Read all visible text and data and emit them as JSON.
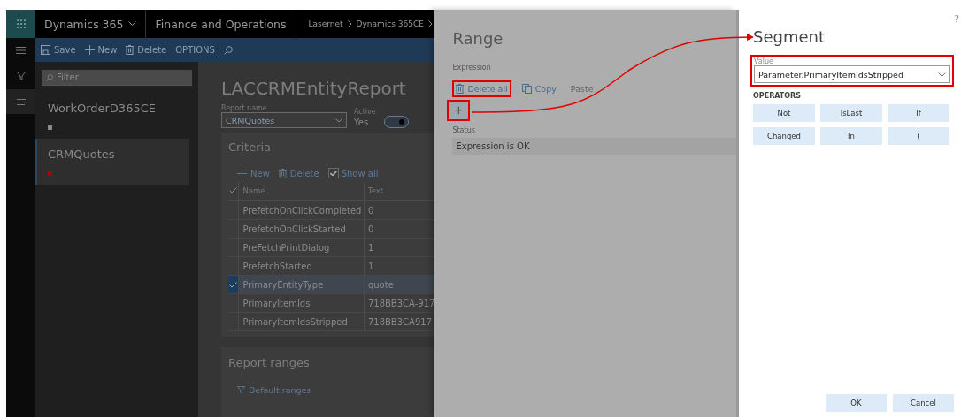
{
  "app_bar": {
    "product": "Dynamics 365",
    "module": "Finance and Operations",
    "breadcrumb": [
      "Lasernet",
      "Dynamics 365CE"
    ]
  },
  "action_pane": {
    "buttons": [
      {
        "label": "Save",
        "kind": "save"
      },
      {
        "label": "New",
        "kind": "new"
      },
      {
        "label": "Delete",
        "kind": "delete"
      },
      {
        "label": "OPTIONS",
        "kind": "text"
      }
    ]
  },
  "list_pane": {
    "filter_placeholder": "Filter",
    "items": [
      {
        "name": "WorkOrderD365CE",
        "color": "#8a8a8a",
        "selected": false
      },
      {
        "name": "CRMQuotes",
        "color": "#b00000",
        "selected": true
      }
    ]
  },
  "form": {
    "title": "LACCRMEntityReport",
    "report_name": {
      "label": "Report name",
      "value": "CRMQuotes"
    },
    "active": {
      "label": "Active",
      "value": "Yes",
      "on": true
    },
    "criteria": {
      "title": "Criteria",
      "actions": [
        {
          "label": "New",
          "kind": "new"
        },
        {
          "label": "Delete",
          "kind": "delete"
        },
        {
          "label": "Show all",
          "kind": "checkbox",
          "checked": true
        }
      ],
      "columns": [
        "Name",
        "Text"
      ],
      "rows": [
        {
          "name": "PrefetchOnClickCompleted",
          "text": "0",
          "selected": false
        },
        {
          "name": "PrefetchOnClickStarted",
          "text": "0",
          "selected": false
        },
        {
          "name": "PreFetchPrintDialog",
          "text": "1",
          "selected": false
        },
        {
          "name": "PrefetchStarted",
          "text": "1",
          "selected": false
        },
        {
          "name": "PrimaryEntityType",
          "text": "quote",
          "selected": true
        },
        {
          "name": "PrimaryItemIds",
          "text": "718BB3CA-917",
          "selected": false
        },
        {
          "name": "PrimaryItemIdsStripped",
          "text": "718BB3CA917",
          "selected": false
        }
      ]
    },
    "report_ranges": {
      "title": "Report ranges",
      "action": "Default ranges"
    }
  },
  "range_panel": {
    "title": "Range",
    "expression_label": "Expression",
    "actions": [
      {
        "label": "Delete all",
        "kind": "delete",
        "annotated": true
      },
      {
        "label": "Copy",
        "kind": "copy",
        "annotated": false
      },
      {
        "label": "Paste",
        "kind": "paste",
        "annotated": false
      }
    ],
    "add_button": {
      "label": "+",
      "annotated": true
    },
    "status_label": "Status",
    "status": "Expression is OK"
  },
  "segment_panel": {
    "help": "?",
    "title": "Segment",
    "value_label": "Value",
    "value": "Parameter.PrimaryItemIdsStripped",
    "value_annotated": true,
    "operators_label": "OPERATORS",
    "operators": [
      "Not",
      "IsLast",
      "If",
      "Changed",
      "In",
      "("
    ],
    "buttons": [
      "OK",
      "Cancel"
    ]
  }
}
